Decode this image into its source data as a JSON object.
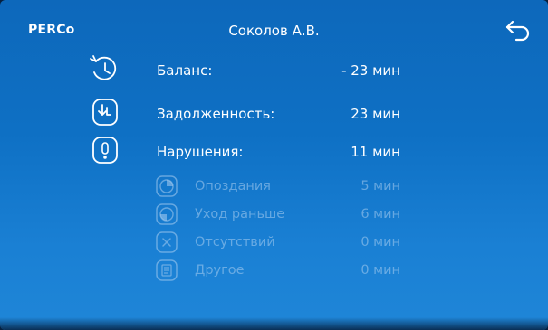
{
  "header": {
    "logo": "PERCo",
    "title": "Соколов А.В.",
    "back_icon": "back-arrow-icon"
  },
  "summary": [
    {
      "label": "Баланс:",
      "value": "- 23 мин",
      "icon": "clock-history-icon"
    },
    {
      "label": "Задолженность:",
      "value": "23 мин",
      "icon": "clock-debt-icon"
    },
    {
      "label": "Нарушения:",
      "value": "11 мин",
      "icon": "warning-icon"
    }
  ],
  "violations": [
    {
      "label": "Опоздания",
      "value": "5 мин",
      "icon": "late-clock-icon"
    },
    {
      "label": "Уход раньше",
      "value": "6 мин",
      "icon": "early-leave-icon"
    },
    {
      "label": "Отсутствий",
      "value": "0 мин",
      "icon": "absence-icon"
    },
    {
      "label": "Другое",
      "value": "0 мин",
      "icon": "other-document-icon"
    }
  ],
  "colors": {
    "background_top": "#0d68bb",
    "background_bottom": "#1f86d8",
    "text_primary": "#ffffff",
    "text_dimmed": "#aacdf0"
  }
}
